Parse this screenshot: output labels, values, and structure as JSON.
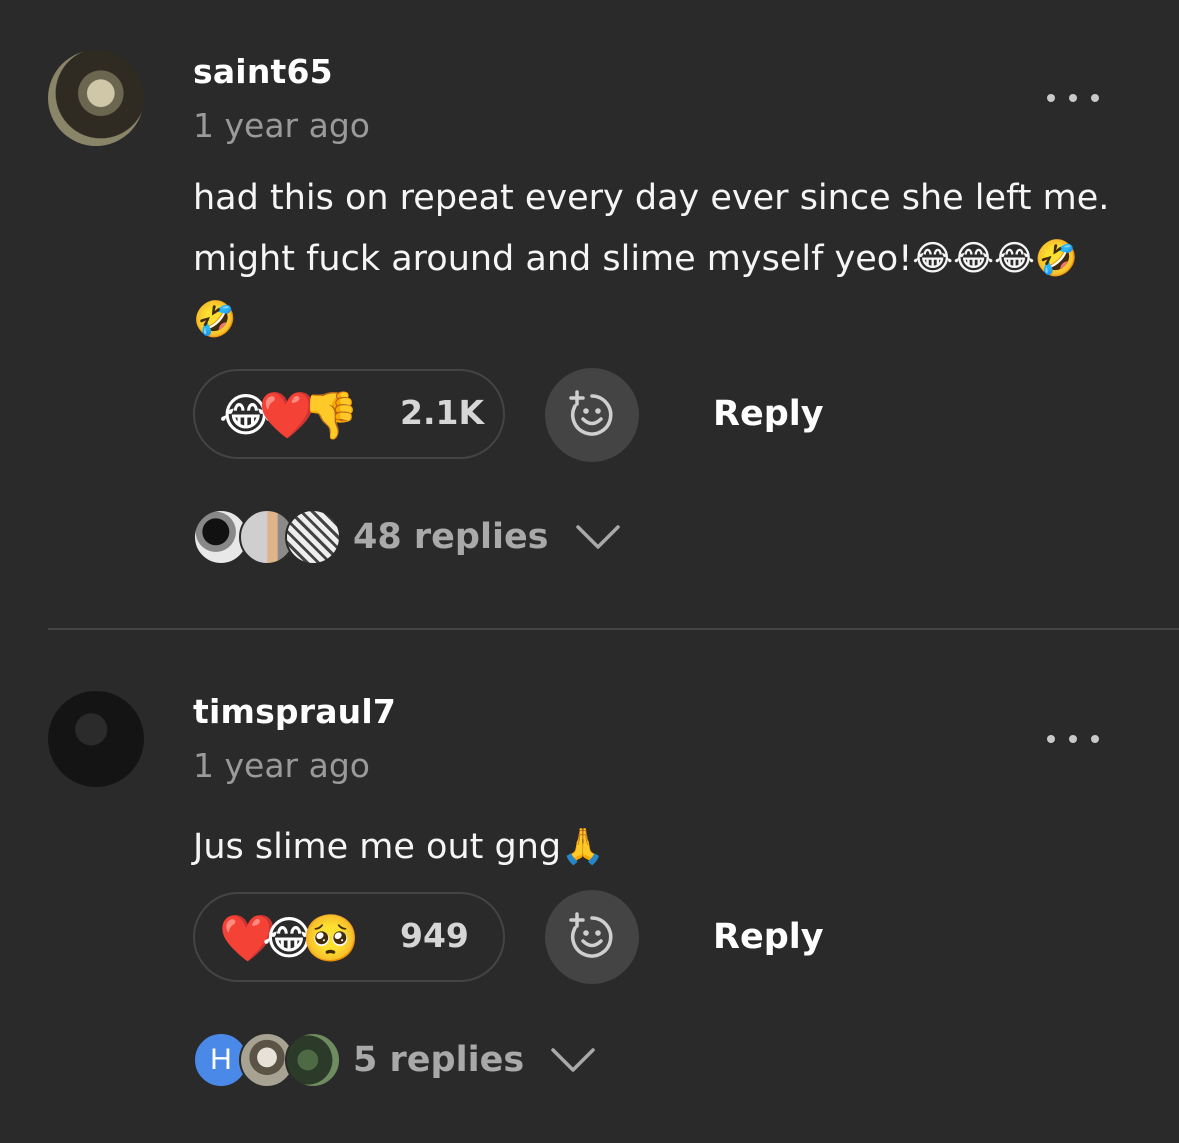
{
  "comments": [
    {
      "username": "saint65",
      "time": "1 year ago",
      "text_line1": "had this on repeat every day ever since she left me.",
      "text_line2": "might fuck around and slime myself yeo!😂😂😂🤣",
      "text_line3": "🤣",
      "reactions": "😂❤️👎",
      "reaction_count": "2.1K",
      "reply_label": "Reply",
      "replies_label": "48 replies"
    },
    {
      "username": "timspraul7",
      "time": "1 year ago",
      "text_line1": "Jus slime me out gng🙏",
      "reactions": "❤️😂🥺",
      "reaction_count": "949",
      "reply_label": "Reply",
      "replies_label": "5 replies",
      "first_replier_initial": "H"
    }
  ],
  "colors": {
    "background": "#2a2a2a",
    "secondary_text": "#9a9a9a",
    "button_bg": "#444444",
    "initial_avatar": "#4a89e8"
  },
  "icons": [
    "more-options-icon",
    "add-reaction-icon",
    "chevron-down-icon"
  ]
}
